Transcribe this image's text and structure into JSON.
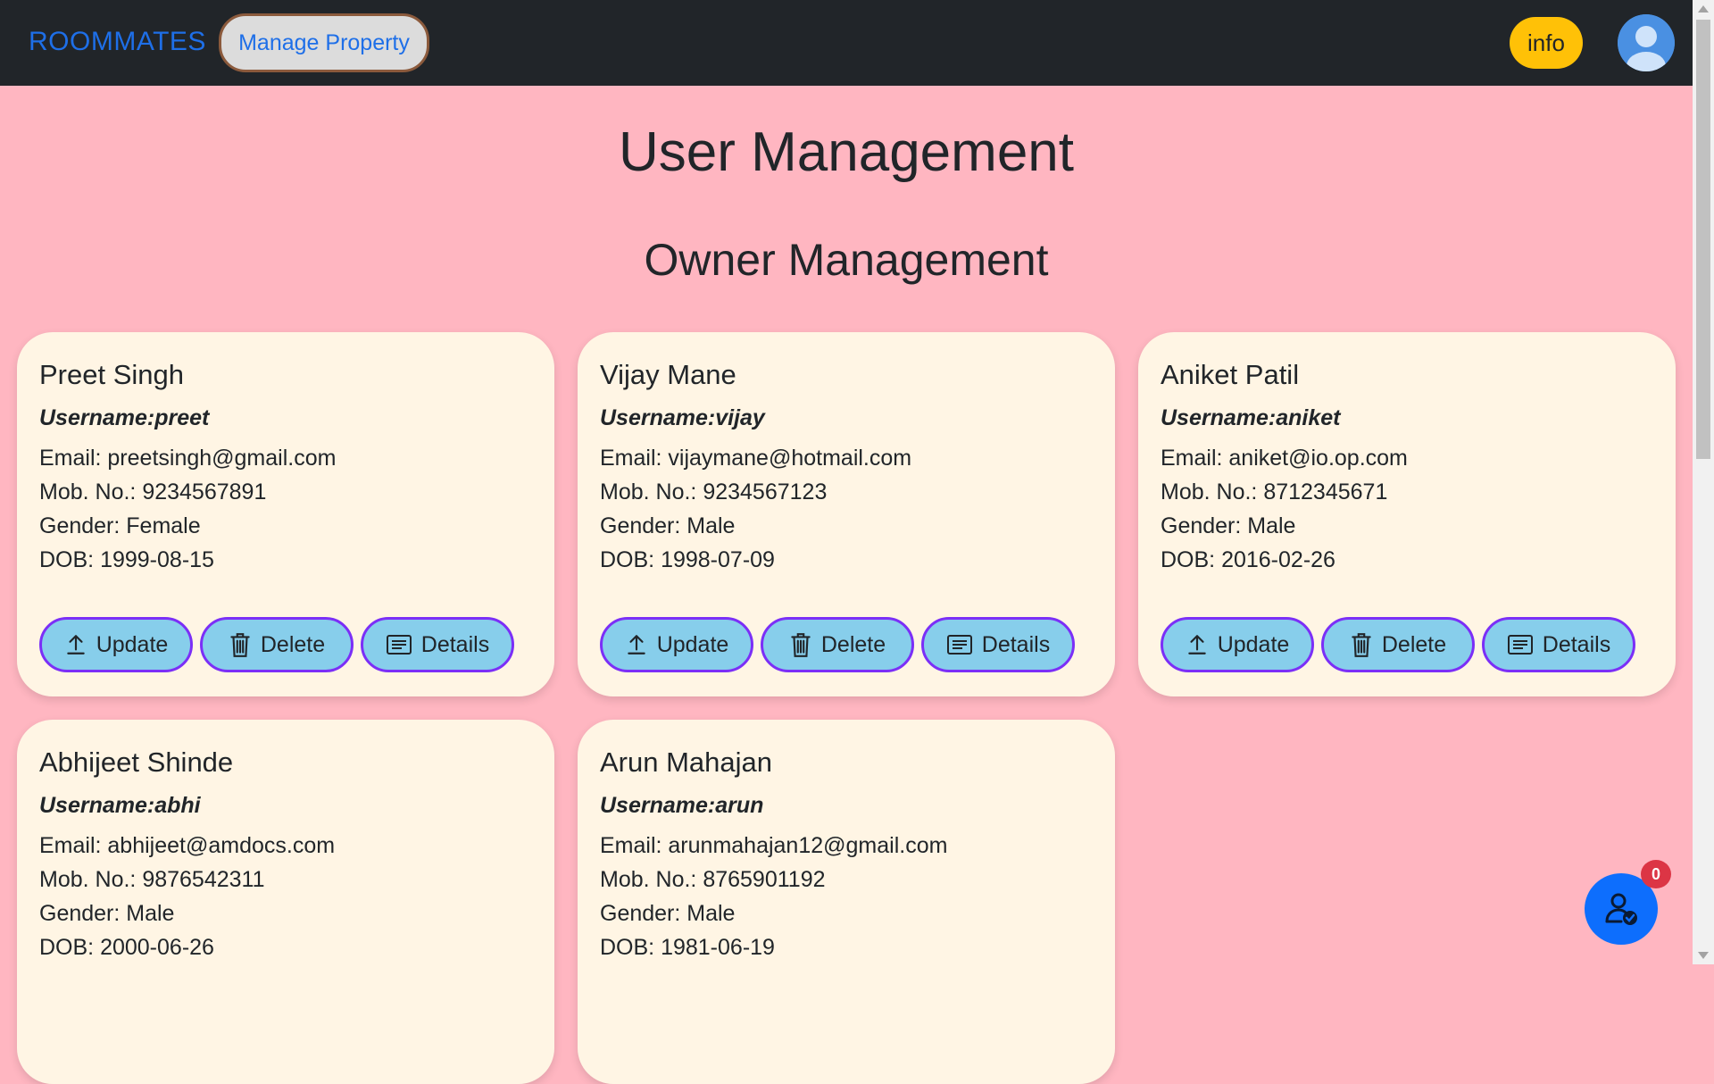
{
  "nav": {
    "brand": "ROOMMATES",
    "manage_property": "Manage Property",
    "info": "info"
  },
  "page": {
    "title": "User Management",
    "section_title": "Owner Management"
  },
  "buttons": {
    "update": "Update",
    "delete": "Delete",
    "details": "Details"
  },
  "owners": [
    {
      "name": "Preet Singh",
      "username": "Username:preet",
      "email": "Email: preetsingh@gmail.com",
      "mobile": "Mob. No.: 9234567891",
      "gender": "Gender: Female",
      "dob": "DOB: 1999-08-15"
    },
    {
      "name": "Vijay Mane",
      "username": "Username:vijay",
      "email": "Email: vijaymane@hotmail.com",
      "mobile": "Mob. No.: 9234567123",
      "gender": "Gender: Male",
      "dob": "DOB: 1998-07-09"
    },
    {
      "name": "Aniket Patil",
      "username": "Username:aniket",
      "email": "Email: aniket@io.op.com",
      "mobile": "Mob. No.: 8712345671",
      "gender": "Gender: Male",
      "dob": "DOB: 2016-02-26"
    },
    {
      "name": "Abhijeet Shinde",
      "username": "Username:abhi",
      "email": "Email: abhijeet@amdocs.com",
      "mobile": "Mob. No.: 9876542311",
      "gender": "Gender: Male",
      "dob": "DOB: 2000-06-26"
    },
    {
      "name": "Arun Mahajan",
      "username": "Username:arun",
      "email": "Email: arunmahajan12@gmail.com",
      "mobile": "Mob. No.: 8765901192",
      "gender": "Gender: Male",
      "dob": "DOB: 1981-06-19"
    }
  ],
  "fab": {
    "badge_count": "0",
    "icon": "user-check-icon"
  },
  "colors": {
    "navbar": "#212529",
    "page_bg": "#FFB6C1",
    "card_bg": "#FFF5E4",
    "brand": "#1E6FE8",
    "info_button": "#FFC107",
    "action_button": "#87CEEB",
    "action_border": "#7B2FF7",
    "fab": "#0D6EFD",
    "badge": "#DC3545"
  }
}
